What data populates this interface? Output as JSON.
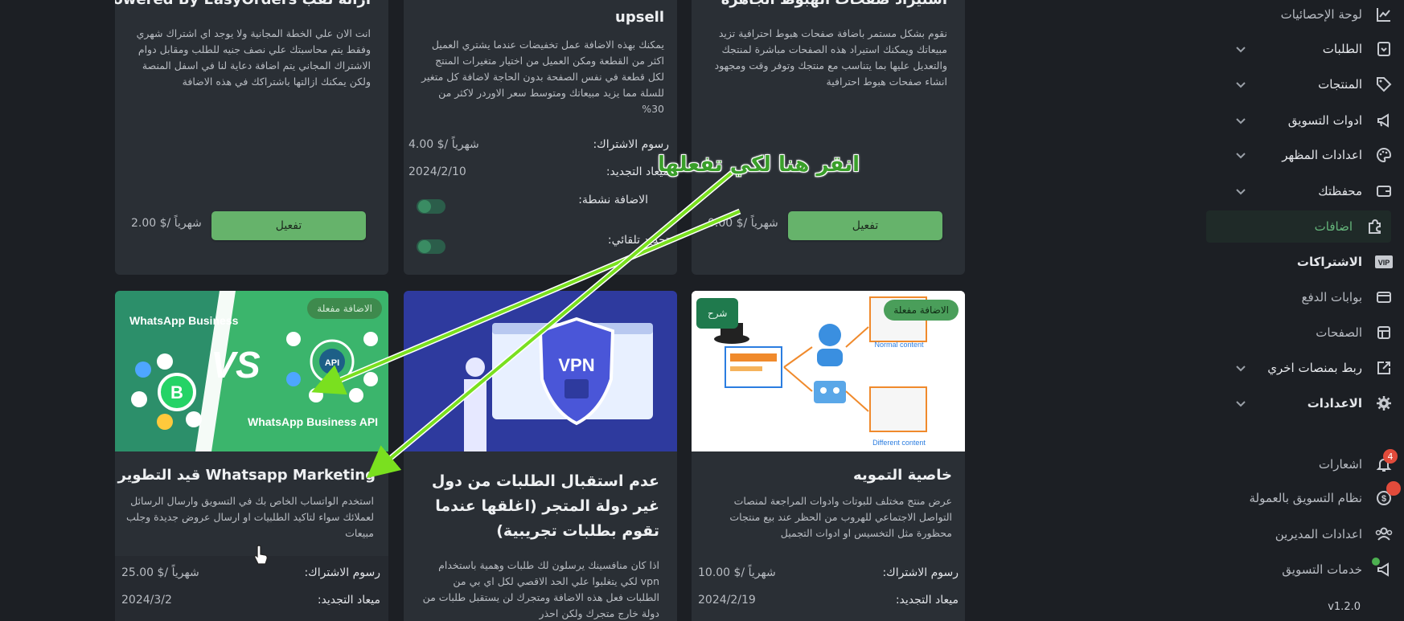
{
  "sidebar": {
    "items": [
      {
        "label": "لوحة الإحصائيات",
        "icon": "chart-line-icon",
        "chevron": false
      },
      {
        "label": "الطلبات",
        "icon": "orders-box-icon",
        "chevron": true
      },
      {
        "label": "المنتجات",
        "icon": "tag-icon",
        "chevron": true
      },
      {
        "label": "ادوات التسويق",
        "icon": "megaphone-icon",
        "chevron": true
      },
      {
        "label": "اعدادات المظهر",
        "icon": "palette-icon",
        "chevron": true
      },
      {
        "label": "محفظتك",
        "icon": "wallet-icon",
        "chevron": true
      },
      {
        "label": "اضافات",
        "icon": "puzzle-icon",
        "chevron": false,
        "active": true
      },
      {
        "label": "الاشتراكات",
        "icon": "vip-icon",
        "chevron": false
      },
      {
        "label": "بوابات الدفع",
        "icon": "credit-card-icon",
        "chevron": false
      },
      {
        "label": "الصفحات",
        "icon": "pages-icon",
        "chevron": false
      },
      {
        "label": "ربط بمنصات اخري",
        "icon": "external-link-icon",
        "chevron": true
      },
      {
        "label": "الاعدادات",
        "icon": "gear-icon",
        "chevron": true
      }
    ],
    "bottom": [
      {
        "label": "اشعارات",
        "icon": "bell-icon",
        "badge": "4"
      },
      {
        "label": "نظام التسويق بالعمولة",
        "icon": "dollar-coin-icon",
        "badge": ""
      },
      {
        "label": "اعدادات المديرين",
        "icon": "users-icon"
      },
      {
        "label": "خدمات التسويق",
        "icon": "megaphone-icon"
      }
    ],
    "version": "v1.2.0"
  },
  "cards_top": [
    {
      "title": "ازالة لقب Powered By EasyOrders",
      "desc": "انت الان علي الخطة المجانية ولا يوجد اي اشتراك شهري وفقط يتم محاسبتك علي نصف جنيه للطلب ومقابل دوام الاشتراك المجاني يتم اضافة دعاية لنا في اسفل المنصة ولكن يمكنك ازالتها باشتراكك في هذه الاضافة",
      "price": "2.00 $/ شهرياً",
      "button": "تفعيل"
    },
    {
      "title": "upsell",
      "desc": "يمكنك بهذه الاضافة عمل تخفيضات عندما يشتري العميل اكثر من القطعة ومكن العميل من اختيار متغيرات المنتج لكل قطعة في نفس الصفحة بدون الحاجة لاضافة كل متغير للسلة مما يزيد مبيعاتك ومتوسط سعر الاوردر لاكثر من 30%",
      "fee_label": "رسوم الاشتراك:",
      "fee_value": "4.00 $/ شهرياً",
      "renew_label": "ميعاد التجديد:",
      "renew_value": "2024/2/10",
      "active_label": "الاضافة نشطة:",
      "auto_label": "تجديد تلقائي:"
    },
    {
      "title": "استيراد صفحات الهبوط الجاهزة",
      "desc": "نقوم بشكل مستمر باضافة صفحات هبوط احترافية تزيد مبيعاتك ويمكنك استيراد هذه الصفحات مباشرة لمنتجك والتعديل عليها بما يتناسب مع منتجك وتوفر وقت ومجهود انشاء صفحات هبوط احترافية",
      "price": "0.00 $/ شهرياً",
      "button": "تفعيل"
    }
  ],
  "cards_bottom": [
    {
      "badge": "الاضافة مفعلة",
      "thumb_left": "WhatsApp Business",
      "thumb_vs": "VS",
      "thumb_api": "API",
      "thumb_b": "B",
      "thumb_right": "WhatsApp Business API",
      "title": "Whatsapp Marketing قيد التطوير",
      "desc": "استخدم الواتساب الخاص بك في التسويق وارسال الرسائل لعملائك سواء لتاكيد الطلبيات او ارسال عروض جديدة وجلب مبيعات",
      "fee_label": "رسوم الاشتراك:",
      "fee_value": "25.00 $/ شهرياً",
      "renew_label": "ميعاد التجديد:",
      "renew_value": "2024/3/2"
    },
    {
      "thumb_text": "VPN",
      "title": "عدم استقبال الطلبات من دول غير دولة المتجر (اغلقها عندما تقوم بطلبات تجريبية)",
      "desc": "اذا كان منافسينك يرسلون لك طلبات وهمية باستخدام vpn لكي يتغلبوا علي الحد الاقصي لكل اي بي من الطلبات فعل هذه الاضافة ومتجرك لن يستقبل طلبات من دولة خارج متجرك ولكن احذر"
    },
    {
      "badge": "الاضافة مفعلة",
      "explain": "شرح",
      "thumb_normal": "Normal content",
      "thumb_different": "Different content",
      "title": "خاصية التمويه",
      "desc": "عرض منتج مختلف للبوتات وادوات المراجعة لمنصات التواصل الاجتماعي للهروب من الحظر عند بيع منتجات محظورة مثل التخسيس او ادوات التجميل",
      "fee_label": "رسوم الاشتراك:",
      "fee_value": "10.00 $/ شهرياً",
      "renew_label": "ميعاد التجديد:",
      "renew_value": "2024/2/19"
    }
  ],
  "annotation": {
    "text": "انقر هنا لكي تفعلها",
    "color": "#7ae01f"
  },
  "colors": {
    "accent": "#66b36b",
    "bg": "#1c1f24",
    "card": "#2a2f35"
  }
}
